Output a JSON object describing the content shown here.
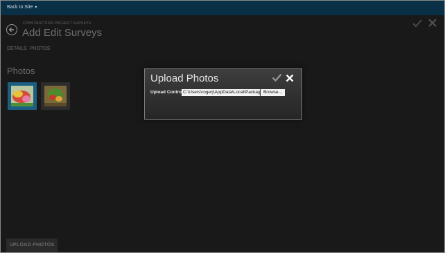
{
  "topbar": {
    "back_label": "Back to Site",
    "chevron": "▾"
  },
  "header": {
    "subtitle": "CONSTRUCTION PROJECT SURVEYS",
    "title": "Add Edit Surveys"
  },
  "tabs": [
    {
      "label": "DETAILS"
    },
    {
      "label": "PHOTOS"
    }
  ],
  "photos": {
    "section_title": "Photos",
    "thumbnails": [
      {
        "icon": "photo-thumbnail-icon",
        "selected": true
      },
      {
        "icon": "photo-thumbnail-icon",
        "selected": false
      }
    ]
  },
  "footer": {
    "upload_button_label": "UPLOAD PHOTOS"
  },
  "modal": {
    "title": "Upload Photos",
    "field_label": "Upload Control",
    "path_value": "C:\\Users\\rogerj\\AppData\\Local\\Package",
    "browse_label": "Browse...",
    "confirm_icon": "checkmark-icon",
    "close_icon": "close-icon"
  },
  "colors": {
    "topbar": "#0a3048",
    "background": "#191919",
    "selected_thumb": "#1c5f83"
  }
}
